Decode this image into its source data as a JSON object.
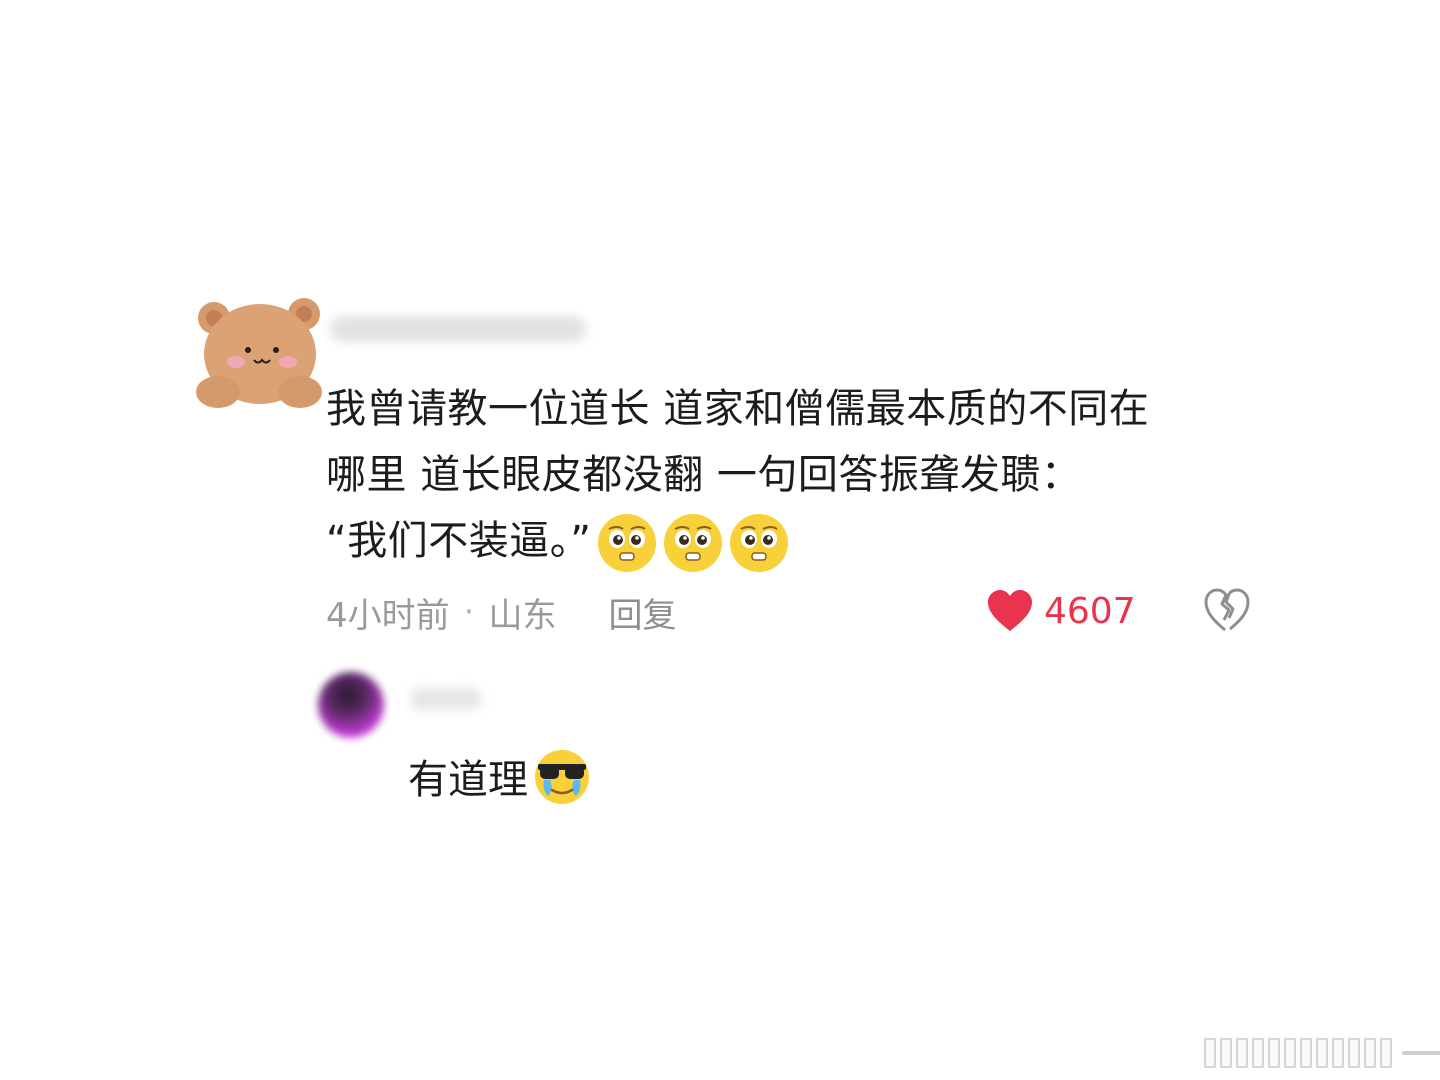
{
  "comment": {
    "lines": [
      "我曾请教一位道长 道家和僧儒最本质的不同在",
      "哪里 道长眼皮都没翻 一句回答振聋发聩：",
      "“我们不装逼。”"
    ],
    "emojis": [
      "pleading-face-icon",
      "pleading-face-icon",
      "pleading-face-icon"
    ],
    "time": "4小时前",
    "separator": "·",
    "location": "山东",
    "reply_label": "回复",
    "likes": "4607",
    "colors": {
      "like": "#e8344f",
      "meta": "#9a9a9a",
      "text": "#1c1c1c"
    }
  },
  "reply": {
    "text": "有道理",
    "emoji": "sunglasses-crying-face-icon"
  }
}
